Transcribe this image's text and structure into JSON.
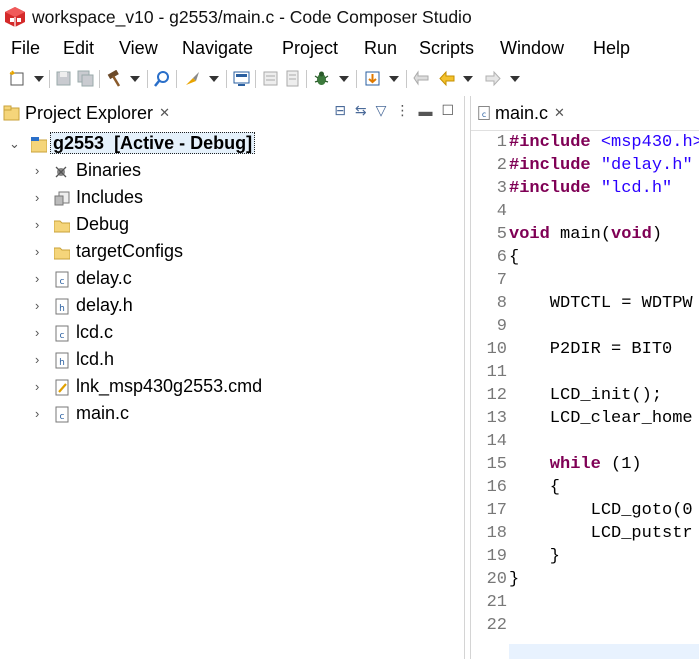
{
  "window": {
    "title": "workspace_v10 - g2553/main.c - Code Composer Studio"
  },
  "menu": [
    "File",
    "Edit",
    "View",
    "Navigate",
    "Project",
    "Run",
    "Scripts",
    "Window",
    "Help"
  ],
  "project_explorer": {
    "tab_label": "Project Explorer",
    "root": {
      "name": "g2553",
      "status": "[Active - Debug]"
    },
    "items": [
      {
        "label": "Binaries",
        "icon": "binaries-icon"
      },
      {
        "label": "Includes",
        "icon": "includes-icon"
      },
      {
        "label": "Debug",
        "icon": "folder-icon"
      },
      {
        "label": "targetConfigs",
        "icon": "folder-icon"
      },
      {
        "label": "delay.c",
        "icon": "c-file-icon"
      },
      {
        "label": "delay.h",
        "icon": "h-file-icon"
      },
      {
        "label": "lcd.c",
        "icon": "c-file-icon"
      },
      {
        "label": "lcd.h",
        "icon": "h-file-icon"
      },
      {
        "label": "lnk_msp430g2553.cmd",
        "icon": "cmd-file-icon"
      },
      {
        "label": "main.c",
        "icon": "c-file-icon"
      }
    ]
  },
  "editor": {
    "tab_label": "main.c",
    "lines": [
      {
        "n": "1",
        "tokens": [
          [
            "kw",
            "#include"
          ],
          [
            "str",
            " <msp430.h>"
          ]
        ]
      },
      {
        "n": "2",
        "tokens": [
          [
            "kw",
            "#include"
          ],
          [
            "str",
            " \"delay.h\""
          ]
        ]
      },
      {
        "n": "3",
        "tokens": [
          [
            "kw",
            "#include"
          ],
          [
            "str",
            " \"lcd.h\""
          ]
        ]
      },
      {
        "n": "4",
        "tokens": []
      },
      {
        "n": "5",
        "tokens": [
          [
            "kw",
            "void"
          ],
          [
            "t",
            " main("
          ],
          [
            "kw",
            "void"
          ],
          [
            "t",
            ")"
          ]
        ]
      },
      {
        "n": "6",
        "tokens": [
          [
            "t",
            "{"
          ]
        ]
      },
      {
        "n": "7",
        "tokens": []
      },
      {
        "n": "8",
        "tokens": [
          [
            "t",
            "    WDTCTL = WDTPW"
          ]
        ]
      },
      {
        "n": "9",
        "tokens": []
      },
      {
        "n": "10",
        "tokens": [
          [
            "t",
            "    P2DIR = BIT0"
          ]
        ]
      },
      {
        "n": "11",
        "tokens": []
      },
      {
        "n": "12",
        "tokens": [
          [
            "t",
            "    LCD_init();"
          ]
        ]
      },
      {
        "n": "13",
        "tokens": [
          [
            "t",
            "    LCD_clear_home"
          ]
        ]
      },
      {
        "n": "14",
        "tokens": []
      },
      {
        "n": "15",
        "tokens": [
          [
            "kw",
            "    while"
          ],
          [
            "t",
            " (1)"
          ]
        ]
      },
      {
        "n": "16",
        "tokens": [
          [
            "t",
            "    {"
          ]
        ]
      },
      {
        "n": "17",
        "tokens": [
          [
            "t",
            "        LCD_goto(0"
          ]
        ]
      },
      {
        "n": "18",
        "tokens": [
          [
            "t",
            "        LCD_putstr"
          ]
        ]
      },
      {
        "n": "19",
        "tokens": [
          [
            "t",
            "    }"
          ]
        ]
      },
      {
        "n": "20",
        "tokens": [
          [
            "t",
            "}"
          ]
        ]
      },
      {
        "n": "21",
        "tokens": []
      },
      {
        "n": "22",
        "tokens": []
      }
    ]
  },
  "colors": {
    "keyword": "#7f0055",
    "string": "#2a00ff",
    "line_number": "#787878",
    "selection": "#e5f1fb"
  }
}
